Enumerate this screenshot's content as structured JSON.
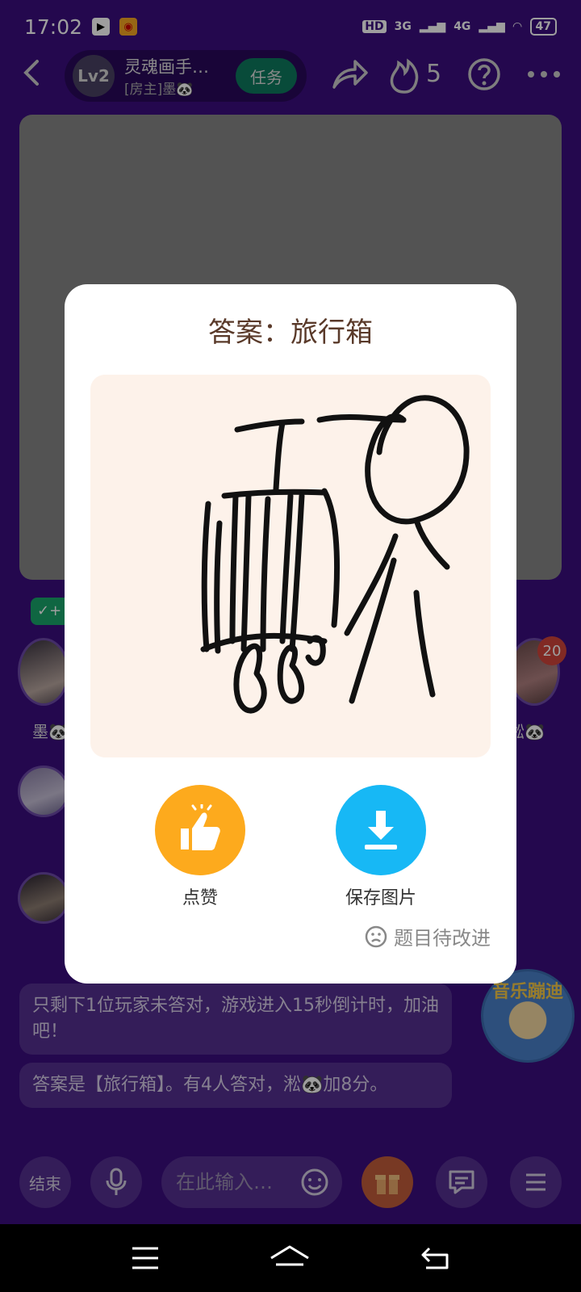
{
  "status_bar": {
    "time": "17:02",
    "network_hd": "HD",
    "net_3g": "3G",
    "net_4g": "4G",
    "battery": "47"
  },
  "room": {
    "level": "Lv2",
    "name": "灵魂画手…",
    "host": "[房主]墨🐼",
    "task_label": "任务",
    "fire_count": "5"
  },
  "players": [
    {
      "name": "墨🐼",
      "tag": "+"
    },
    {
      "name": "淞🐼",
      "score": "20"
    }
  ],
  "chat": [
    "只剩下1位玩家未答对，游戏进入15秒倒计时，加油吧！",
    "答案是【旅行箱】。有4人答对，淞🐼加8分。"
  ],
  "music_badge": "音乐蹦迪",
  "bottom_bar": {
    "end_label": "结束",
    "input_placeholder": "在此输入…"
  },
  "dialog": {
    "title": "答案：旅行箱",
    "like_label": "点赞",
    "save_label": "保存图片",
    "feedback_label": "题目待改进"
  }
}
